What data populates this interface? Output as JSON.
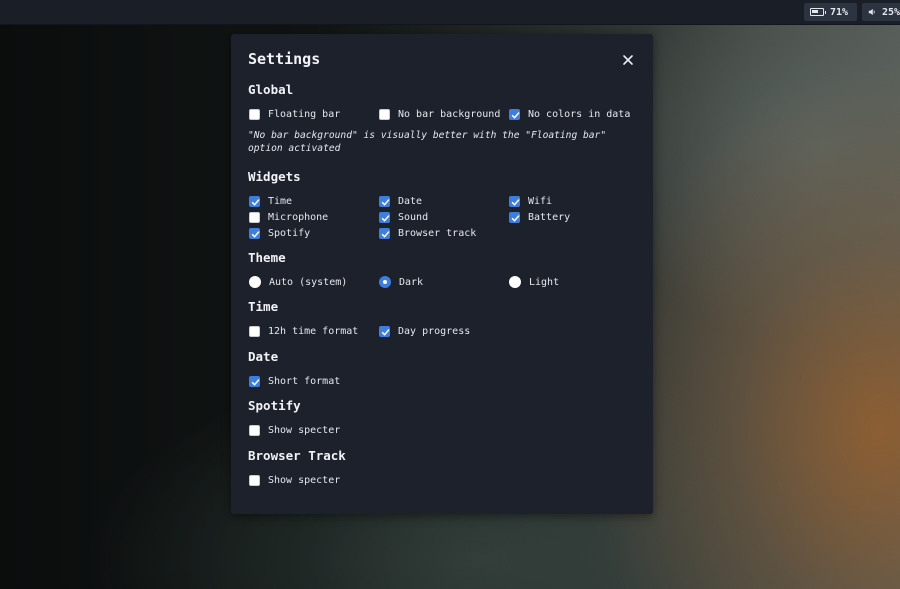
{
  "topbar": {
    "battery": {
      "icon": "battery-icon",
      "label": "71%",
      "level": 0.71
    },
    "volume": {
      "icon": "speaker-icon",
      "label": "25%"
    }
  },
  "settings": {
    "title": "Settings",
    "close_icon": "close-icon",
    "global": {
      "heading": "Global",
      "floating_bar": {
        "label": "Floating bar",
        "checked": false
      },
      "no_bar_background": {
        "label": "No bar background",
        "checked": false
      },
      "no_colors_in_data": {
        "label": "No colors in data",
        "checked": true
      },
      "note": "\"No bar background\" is visually better with the \"Floating bar\" option activated"
    },
    "widgets": {
      "heading": "Widgets",
      "time": {
        "label": "Time",
        "checked": true
      },
      "date": {
        "label": "Date",
        "checked": true
      },
      "wifi": {
        "label": "Wifi",
        "checked": true
      },
      "microphone": {
        "label": "Microphone",
        "checked": false
      },
      "sound": {
        "label": "Sound",
        "checked": true
      },
      "battery": {
        "label": "Battery",
        "checked": true
      },
      "spotify": {
        "label": "Spotify",
        "checked": true
      },
      "browser_track": {
        "label": "Browser track",
        "checked": true
      }
    },
    "theme": {
      "heading": "Theme",
      "auto": {
        "label": "Auto (system)",
        "selected": false
      },
      "dark": {
        "label": "Dark",
        "selected": true
      },
      "light": {
        "label": "Light",
        "selected": false
      }
    },
    "time": {
      "heading": "Time",
      "h12": {
        "label": "12h time format",
        "checked": false
      },
      "day_progress": {
        "label": "Day progress",
        "checked": true
      }
    },
    "date": {
      "heading": "Date",
      "short_format": {
        "label": "Short format",
        "checked": true
      }
    },
    "spotify": {
      "heading": "Spotify",
      "show_specter": {
        "label": "Show specter",
        "checked": false
      }
    },
    "browser_track": {
      "heading": "Browser Track",
      "show_specter": {
        "label": "Show specter",
        "checked": false
      }
    }
  },
  "colors": {
    "accent": "#3d7ee0",
    "panel_bg": "#1c212b",
    "topbar_bg": "#1a1e27"
  }
}
